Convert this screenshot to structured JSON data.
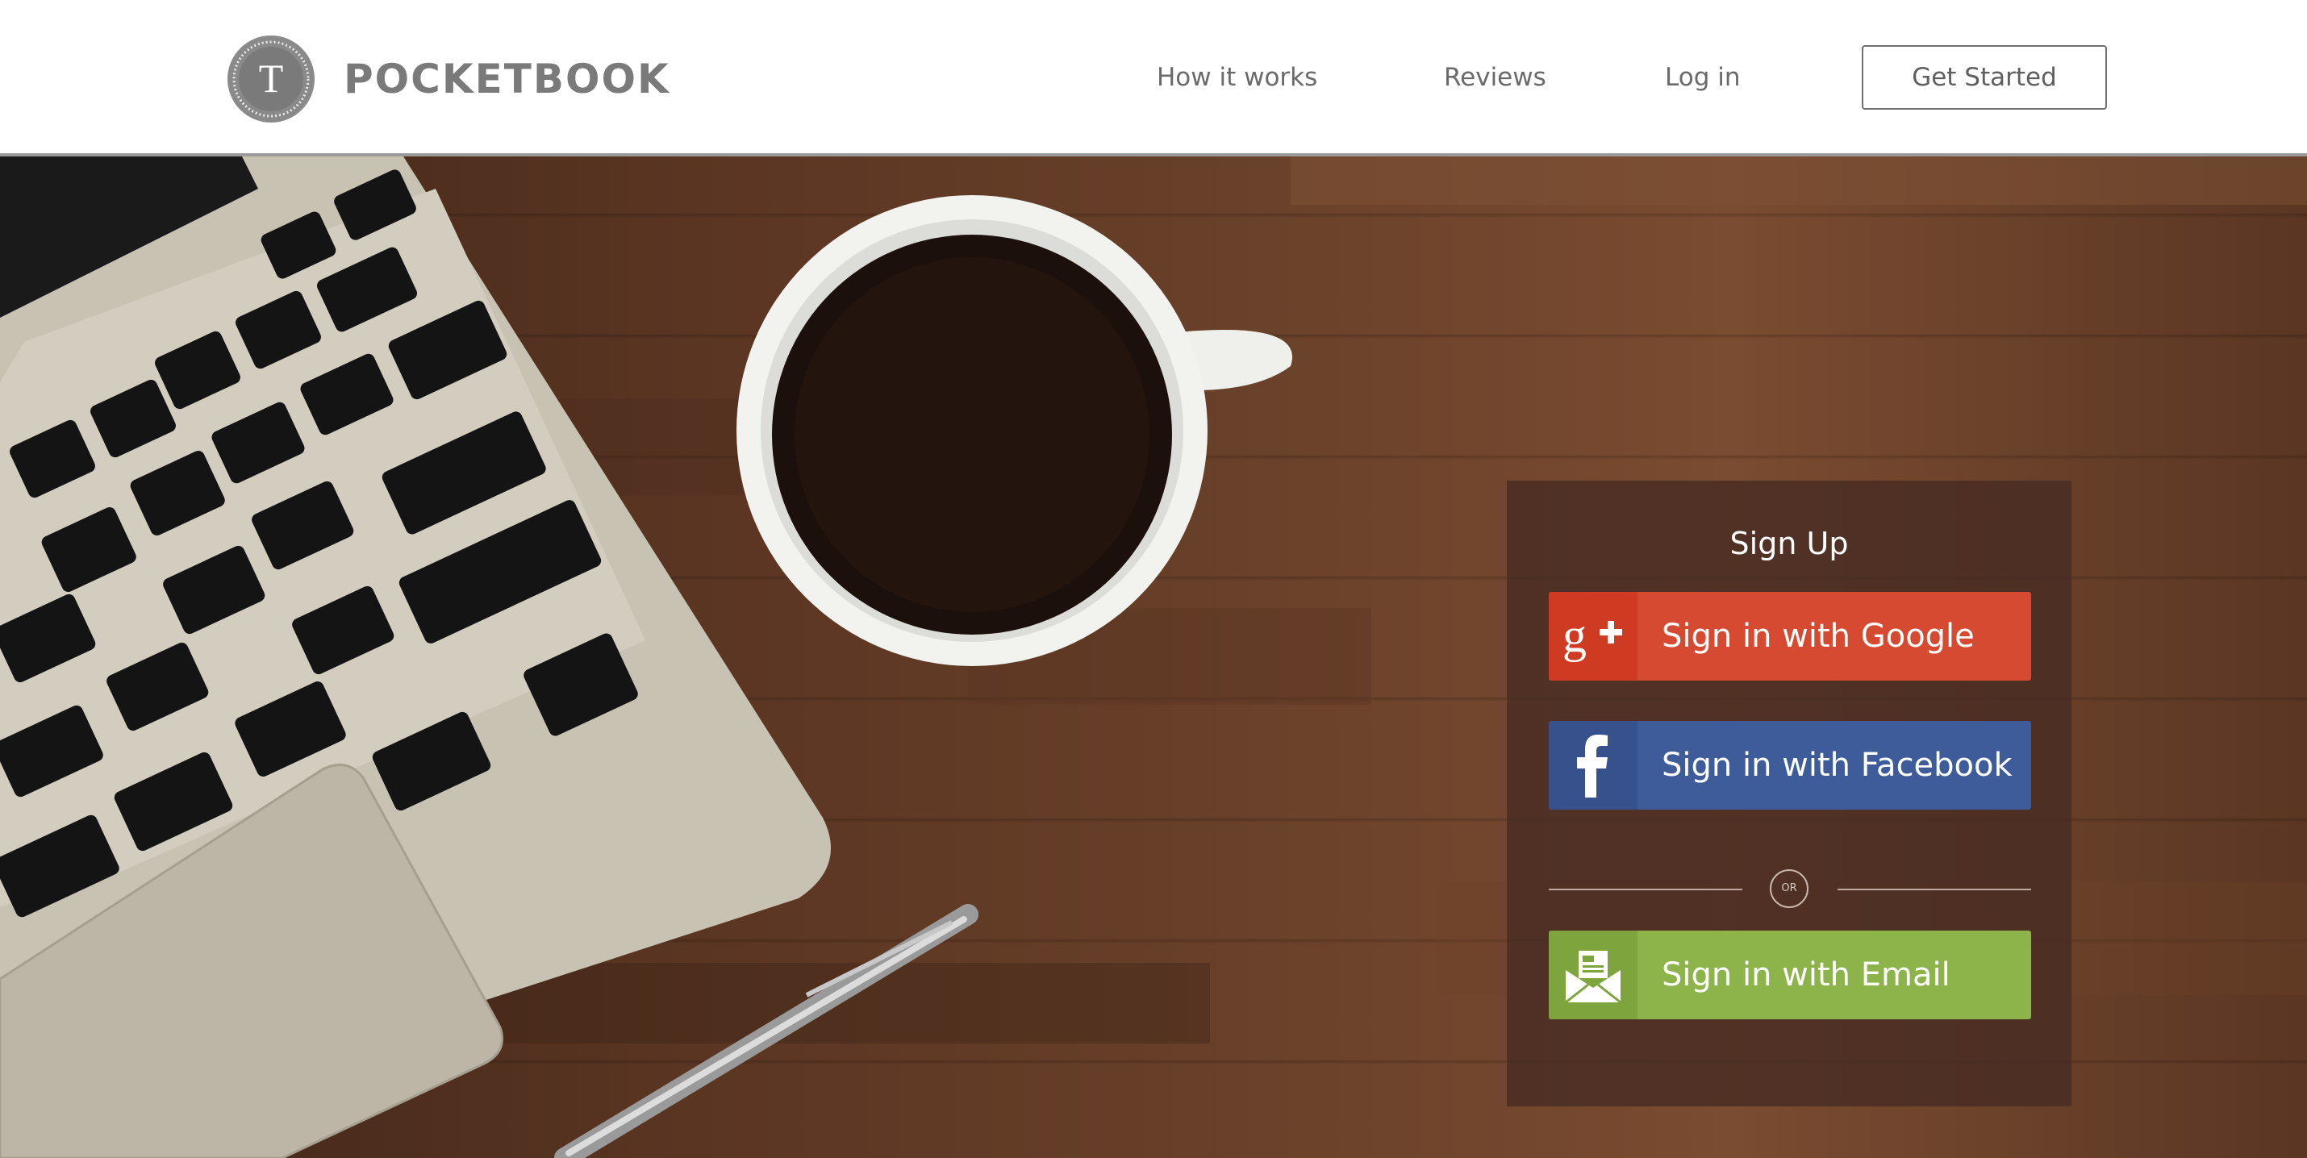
{
  "header": {
    "brand_initial": "T",
    "brand_name": "POCKETBOOK",
    "nav": {
      "how_it_works": "How it works",
      "reviews": "Reviews",
      "log_in": "Log in"
    },
    "cta_label": "Get Started"
  },
  "signup": {
    "title": "Sign Up",
    "google_label": "Sign in with Google",
    "google_icon": "google-plus-icon",
    "facebook_label": "Sign in with Facebook",
    "facebook_icon": "facebook-icon",
    "or_label": "OR",
    "email_label": "Sign in with Email",
    "email_icon": "envelope-icon"
  },
  "colors": {
    "google": "#d64a31",
    "facebook": "#3f5c9a",
    "email": "#8db44b",
    "brand_gray": "#7a7a7a"
  }
}
